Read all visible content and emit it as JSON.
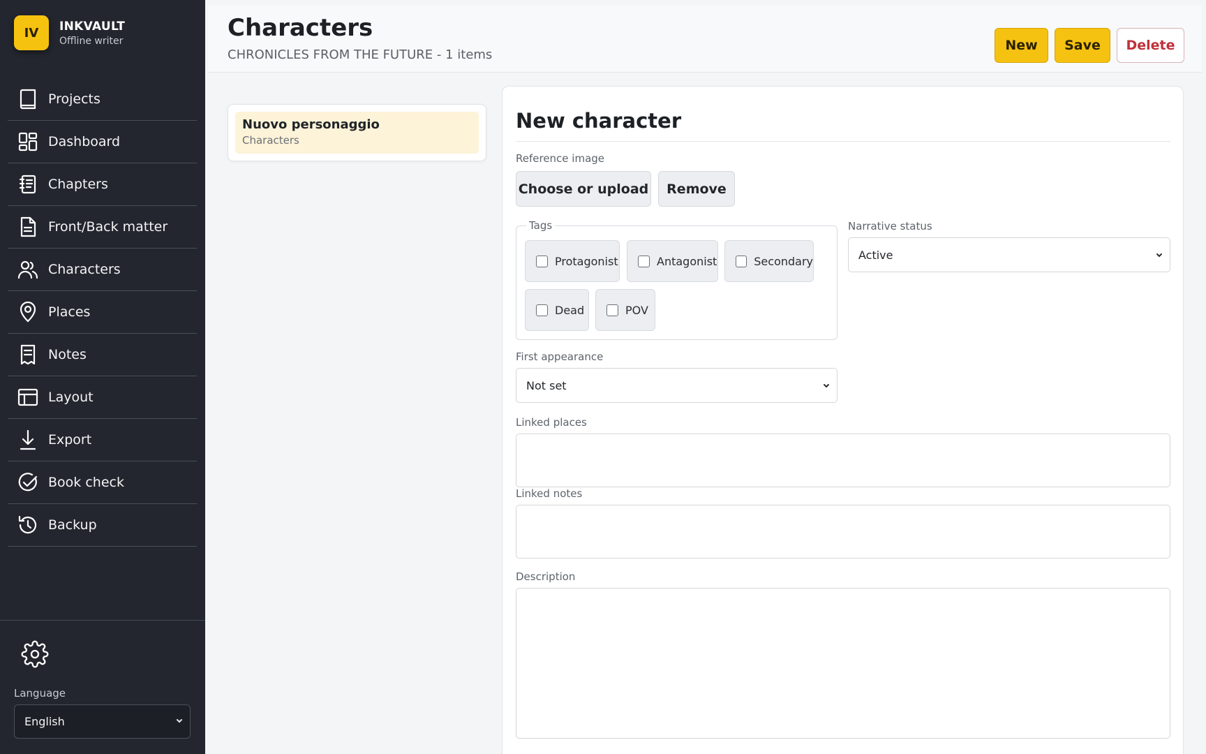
{
  "brand": {
    "initials": "IV",
    "name": "INKVAULT",
    "subtitle": "Offline writer"
  },
  "nav": [
    {
      "label": "Projects",
      "icon": "book-icon"
    },
    {
      "label": "Dashboard",
      "icon": "dashboard-icon"
    },
    {
      "label": "Chapters",
      "icon": "chapters-icon"
    },
    {
      "label": "Front/Back matter",
      "icon": "document-icon"
    },
    {
      "label": "Characters",
      "icon": "users-icon"
    },
    {
      "label": "Places",
      "icon": "map-pin-icon"
    },
    {
      "label": "Notes",
      "icon": "notes-icon"
    },
    {
      "label": "Layout",
      "icon": "layout-icon"
    },
    {
      "label": "Export",
      "icon": "download-icon"
    },
    {
      "label": "Book check",
      "icon": "check-circle-icon"
    },
    {
      "label": "Backup",
      "icon": "history-icon"
    }
  ],
  "settings": {
    "language_label": "Language",
    "language_value": "English"
  },
  "header": {
    "title": "Characters",
    "subtitle": "CHRONICLES FROM THE FUTURE - 1 items",
    "new_label": "New",
    "save_label": "Save",
    "delete_label": "Delete"
  },
  "list": [
    {
      "title": "Nuovo personaggio",
      "subtitle": "Characters"
    }
  ],
  "editor": {
    "title": "New character",
    "reference_image_label": "Reference image",
    "choose_label": "Choose or upload",
    "remove_label": "Remove",
    "tags_label": "Tags",
    "tags": [
      "Protagonist",
      "Antagonist",
      "Secondary",
      "Dead",
      "POV"
    ],
    "narrative_status_label": "Narrative status",
    "narrative_status_value": "Active",
    "first_appearance_label": "First appearance",
    "first_appearance_value": "Not set",
    "linked_places_label": "Linked places",
    "linked_notes_label": "Linked notes",
    "description_label": "Description"
  },
  "colors": {
    "accent": "#f6c211",
    "sidebar": "#23262e",
    "danger": "#c0303a",
    "selected_item": "#fdf3d8"
  }
}
